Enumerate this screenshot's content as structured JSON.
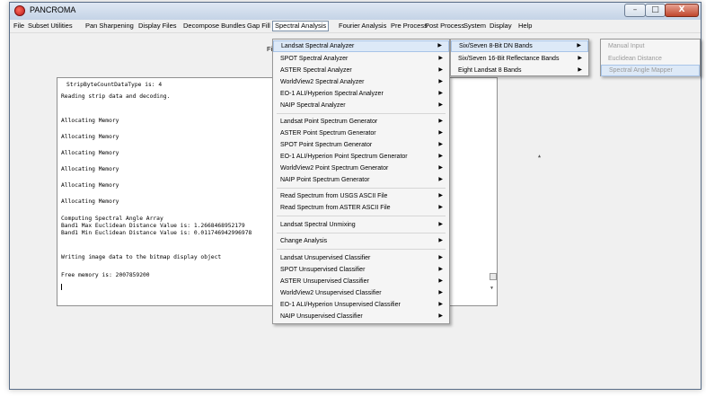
{
  "window": {
    "title": "PANCROMA"
  },
  "window_buttons": {
    "min": "–",
    "max": "□",
    "close": "X"
  },
  "menubar": [
    "File",
    "Subset Utilities",
    "Pan Sharpening",
    "Display Files",
    "Decompose Bundles",
    "Gap Fill",
    "Spectral Analysis",
    "Fourier Analysis",
    "Pre Process",
    "Post Process",
    "System",
    "Display",
    "Help"
  ],
  "active_menu": "Spectral Analysis",
  "partial_label": "Fi",
  "console": {
    "lines": [
      "StripByteCountDataType is:                4",
      "Reading strip data and decoding.",
      "Allocating Memory",
      "Allocating Memory",
      "Allocating Memory",
      "Allocating Memory",
      "Allocating Memory",
      "Allocating Memory",
      "Computing Spectral Angle Array",
      "Band1 Max Euclidean Distance Value is: 1.2668468952179",
      "Band1 Min Euclidean Distance Value is: 0.011746942996978",
      "Writing image data to the bitmap display object",
      "Free memory is: 2007859200"
    ]
  },
  "spectral_menu": [
    "Landsat Spectral Analyzer",
    "SPOT Spectral Analyzer",
    "ASTER Spectral Analyzer",
    "WorldView2 Spectral Analyzer",
    "EO-1 ALI/Hyperion Spectral Analyzer",
    "NAIP Spectral Analyzer",
    "Landsat Point Spectrum Generator",
    "ASTER Point Spectrum Generator",
    "SPOT Point Spectrum Generator",
    "EO-1 ALI/Hyperion Point Spectrum Generator",
    "WorldView2 Point Spectrum Generator",
    "NAIP Point Spectrum Generator",
    "Read Spectrum from USGS ASCII File",
    "Read Spectrum from ASTER ASCII File",
    "Landsat Spectral Unmixing",
    "Change Analysis",
    "Landsat Unsupervised Classifier",
    "SPOT Unsupervised Classifier",
    "ASTER Unsupervised Classifier",
    "WorldView2 Unsupervised Classifier",
    "EO-1 ALI/Hyperion Unsupervised Classifier",
    "NAIP Unsupervised Classifier"
  ],
  "landsat_submenu": [
    "Six/Seven 8-Bit DN Bands",
    "Six/Seven 16-Bit Reflectance Bands",
    "Eight Landsat 8 Bands"
  ],
  "dn_bands_submenu": [
    "Manual Input",
    "Euclidean Distance",
    "Spectral Angle Mapper"
  ],
  "arrow_glyph": "▶"
}
